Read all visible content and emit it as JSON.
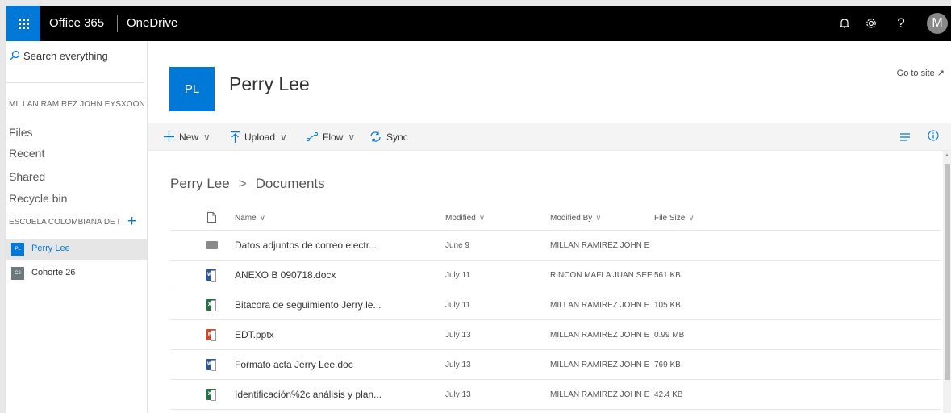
{
  "topbar": {
    "brand": "Office 365",
    "app": "OneDrive",
    "avatar_initial": "M",
    "help_glyph": "?",
    "icons": [
      "waffle-icon",
      "bell-icon",
      "gear-icon",
      "help-icon"
    ]
  },
  "nav": {
    "search_placeholder": "Search everything",
    "owner": "MILLAN RAMIREZ JOHN EYSXOON",
    "links": [
      "Files",
      "Recent",
      "Shared",
      "Recycle bin"
    ],
    "org": "ESCUELA COLOMBIANA DE I",
    "sites": [
      {
        "badge": "PL",
        "label": "Perry Lee",
        "color": "#0078d7"
      },
      {
        "badge": "C2",
        "label": "Cohorte 26",
        "color": "#69797e"
      }
    ]
  },
  "header": {
    "tile": "PL",
    "title": "Perry Lee",
    "goto": "Go to site ↗"
  },
  "commands": {
    "new": "New",
    "upload": "Upload",
    "flow": "Flow",
    "sync": "Sync"
  },
  "breadcrumb": {
    "site": "Perry Lee",
    "sep": ">",
    "library": "Documents"
  },
  "columns": {
    "name": "Name",
    "modified": "Modified",
    "modified_by": "Modified By",
    "size": "File Size"
  },
  "files": [
    {
      "type": "folder",
      "name": "Datos adjuntos de correo electr...",
      "modified": "June 9",
      "by": "MILLAN RAMIREZ JOHN E",
      "size": ""
    },
    {
      "type": "word",
      "name": "ANEXO B 090718.docx",
      "modified": "July 11",
      "by": "RINCON MAFLA JUAN SEE",
      "size": "561 KB"
    },
    {
      "type": "excel",
      "name": "Bitacora de seguimiento Jerry le...",
      "modified": "July 11",
      "by": "MILLAN RAMIREZ JOHN E",
      "size": "105 KB"
    },
    {
      "type": "powerpoint",
      "name": "EDT.pptx",
      "modified": "July 13",
      "by": "MILLAN RAMIREZ JOHN E",
      "size": "0.99 MB"
    },
    {
      "type": "word",
      "name": "Formato acta Jerry Lee.doc",
      "modified": "July 13",
      "by": "MILLAN RAMIREZ JOHN E",
      "size": "769 KB"
    },
    {
      "type": "excel",
      "name": "Identificación%2c análisis y plan...",
      "modified": "July 13",
      "by": "MILLAN RAMIREZ JOHN E",
      "size": "42.4 KB"
    }
  ],
  "colors": {
    "accent": "#0078d7",
    "word": "#2b579a",
    "excel": "#217346",
    "powerpoint": "#d24726"
  }
}
